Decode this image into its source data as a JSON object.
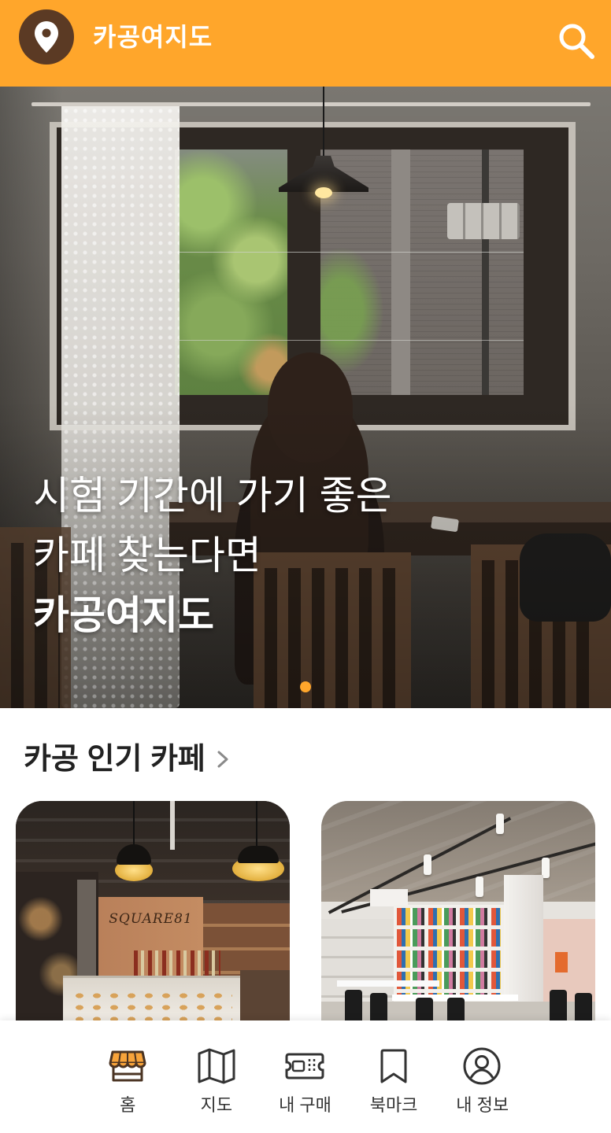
{
  "header": {
    "title": "카공여지도",
    "logo_icon": "location-pin-icon",
    "search_icon": "search-icon"
  },
  "hero": {
    "lines": [
      "시험 기간에 가기 좋은",
      "카페 찾는다면",
      "카공여지도"
    ],
    "slide_count": 1,
    "active_slide_index": 0
  },
  "popular": {
    "title": "카공 인기 카페",
    "more_icon": "chevron-right-icon",
    "cafes": [
      {
        "sign_text": "SQUARE81"
      },
      {}
    ]
  },
  "nav": {
    "items": [
      {
        "label": "홈",
        "icon": "store-icon",
        "active": true
      },
      {
        "label": "지도",
        "icon": "map-icon",
        "active": false
      },
      {
        "label": "내 구매",
        "icon": "ticket-icon",
        "active": false
      },
      {
        "label": "북마크",
        "icon": "bookmark-icon",
        "active": false
      },
      {
        "label": "내 정보",
        "icon": "profile-icon",
        "active": false
      }
    ]
  },
  "colors": {
    "accent": "#FFA62B",
    "brand_dark": "#5B3A24",
    "text": "#222222",
    "muted": "#8A8A8A",
    "nav_background": "#FFFFFF"
  }
}
